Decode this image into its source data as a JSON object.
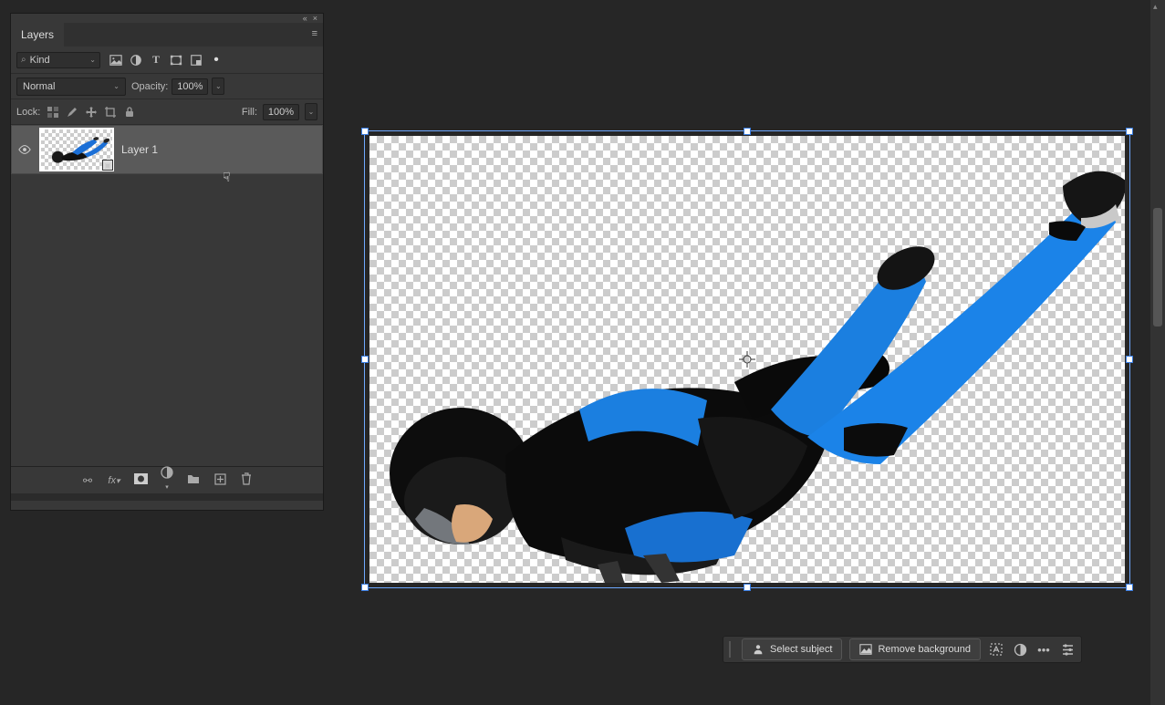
{
  "panel": {
    "title": "Layers",
    "collapse_glyph": "«",
    "close_glyph": "×",
    "menu_glyph": "≡",
    "filter": {
      "search_glyph": "⌕",
      "mode": "Kind",
      "chevron": "⌄",
      "icons": [
        "image",
        "adjust",
        "text",
        "shape",
        "smart",
        "artboard"
      ]
    },
    "blend": {
      "mode": "Normal",
      "opacity_label": "Opacity:",
      "opacity_value": "100%",
      "chevron": "⌄"
    },
    "lock": {
      "label": "Lock:",
      "icons": [
        "pixels",
        "brush",
        "move",
        "crop",
        "all"
      ],
      "fill_label": "Fill:",
      "fill_value": "100%"
    },
    "layers": [
      {
        "name": "Layer 1",
        "visible": true,
        "smart": true
      }
    ],
    "bottom_icons": [
      "link",
      "fx",
      "mask",
      "adjust",
      "group",
      "new",
      "trash"
    ]
  },
  "bottom_bar": {
    "select_subject": "Select subject",
    "remove_background": "Remove background"
  },
  "cursor_glyph": "☟"
}
